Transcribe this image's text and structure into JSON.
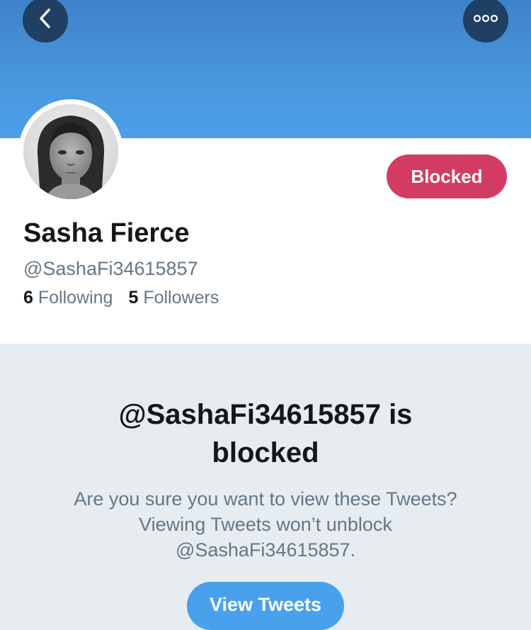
{
  "header": {
    "back_icon": "chevron-left-icon",
    "more_icon": "more-horizontal-icon"
  },
  "profile": {
    "avatar_alt": "profile photo",
    "blocked_button_label": "Blocked",
    "display_name": "Sasha Fierce",
    "handle": "@SashaFi34615857",
    "following_count": "6",
    "following_label": "Following",
    "followers_count": "5",
    "followers_label": "Followers"
  },
  "blocked_notice": {
    "title_line1": "@SashaFi34615857 is",
    "title_line2": "blocked",
    "desc_line1": "Are you sure you want to view these Tweets?",
    "desc_line2": "Viewing Tweets won’t unblock",
    "desc_line3": "@SashaFi34615857.",
    "view_button_label": "View Tweets"
  },
  "colors": {
    "banner": "#4896dc",
    "header_button": "#1f3f63",
    "blocked_button": "#d33c62",
    "view_button": "#4aa1eb",
    "secondary_text": "#657786"
  }
}
